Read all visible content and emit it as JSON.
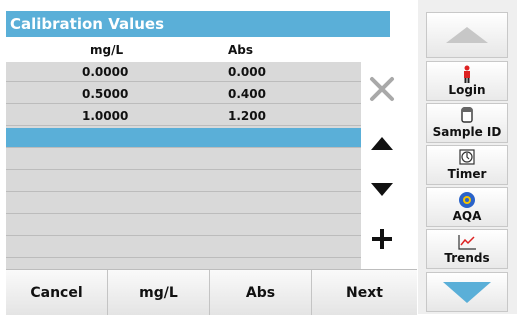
{
  "title": "Calibration Values",
  "columns": {
    "col1": "mg/L",
    "col2": "Abs"
  },
  "rows": [
    {
      "c1": "0.0000",
      "c2": "0.000"
    },
    {
      "c1": "0.5000",
      "c2": "0.400"
    },
    {
      "c1": "1.0000",
      "c2": "1.200"
    },
    {
      "c1": "",
      "c2": ""
    },
    {
      "c1": "",
      "c2": ""
    },
    {
      "c1": "",
      "c2": ""
    },
    {
      "c1": "",
      "c2": ""
    },
    {
      "c1": "",
      "c2": ""
    },
    {
      "c1": "",
      "c2": ""
    },
    {
      "c1": "",
      "c2": ""
    }
  ],
  "bottom": {
    "cancel": "Cancel",
    "mgl": "mg/L",
    "abs": "Abs",
    "next": "Next"
  },
  "tools": {
    "login": "Login",
    "sample_id": "Sample ID",
    "timer": "Timer",
    "aqa": "AQA",
    "trends": "Trends"
  },
  "icons": {
    "delete": "close-icon",
    "up": "triangle-up-icon",
    "down": "triangle-down-icon",
    "add": "plus-icon"
  },
  "colors": {
    "accent": "#5aafd8",
    "table": "#d9d9d9"
  }
}
